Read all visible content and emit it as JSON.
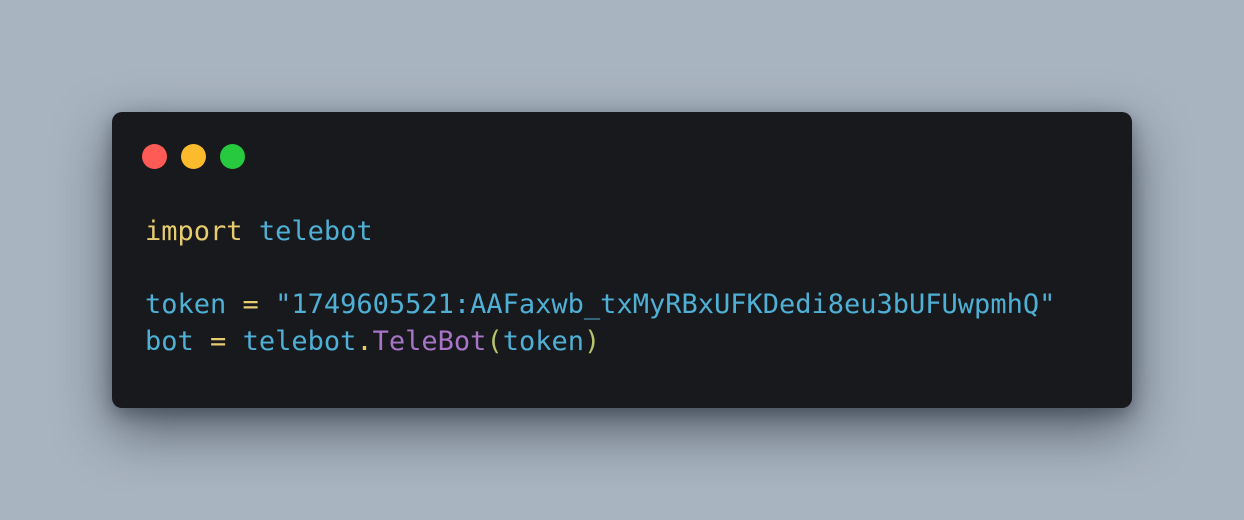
{
  "window": {
    "controls": {
      "close_color": "#fe5a56",
      "minimize_color": "#fcbb2d",
      "maximize_color": "#27c93f"
    }
  },
  "code": {
    "lines": [
      {
        "tokens": [
          {
            "text": "import",
            "type": "keyword"
          },
          {
            "text": " ",
            "type": "space"
          },
          {
            "text": "telebot",
            "type": "identifier"
          }
        ]
      },
      {
        "tokens": []
      },
      {
        "tokens": [
          {
            "text": "token",
            "type": "identifier"
          },
          {
            "text": " ",
            "type": "space"
          },
          {
            "text": "=",
            "type": "operator"
          },
          {
            "text": " ",
            "type": "space"
          },
          {
            "text": "\"1749605521:AAFaxwb_txMyRBxUFKDedi8eu3bUFUwpmhQ\"",
            "type": "string"
          }
        ]
      },
      {
        "tokens": [
          {
            "text": "bot",
            "type": "identifier"
          },
          {
            "text": " ",
            "type": "space"
          },
          {
            "text": "=",
            "type": "operator"
          },
          {
            "text": " ",
            "type": "space"
          },
          {
            "text": "telebot",
            "type": "identifier"
          },
          {
            "text": ".",
            "type": "operator"
          },
          {
            "text": "TeleBot",
            "type": "function"
          },
          {
            "text": "(",
            "type": "punct"
          },
          {
            "text": "token",
            "type": "identifier"
          },
          {
            "text": ")",
            "type": "punct"
          }
        ]
      }
    ]
  }
}
